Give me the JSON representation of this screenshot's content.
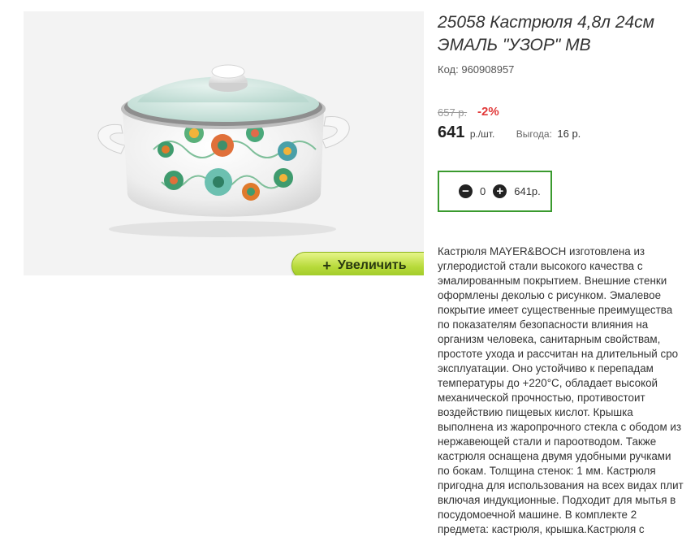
{
  "product": {
    "title": "25058 Кастрюля 4,8л 24см\nЭМАЛЬ \"УЗОР\" MB",
    "sku_label": "Код:",
    "sku_value": "960908957",
    "old_price": "657 р.",
    "discount": "-2%",
    "price": "641",
    "price_unit": "р./шт.",
    "benefit_label": "Выгода:",
    "benefit_value": "16 р."
  },
  "image": {
    "zoom_plus": "+",
    "zoom_label": "Увеличить"
  },
  "quantity": {
    "minus": "−",
    "value": "0",
    "plus": "+",
    "total": "641р."
  },
  "description": "Кастрюля MAYER&BOCH изготовлена из\nуглеродистой стали высокого качества с\nэмалированным покрытием. Внешние стенки\nоформлены деколью с рисунком. Эмалевое\nпокрытие имеет существенные преимущества\nпо показателям безопасности влияния на\nорганизм человека, санитарным свойствам,\nпростоте ухода и рассчитан на длительный сро\nэксплуатации. Оно устойчиво к перепадам\nтемпературы до +220°С, обладает высокой\nмеханической прочностью, противостоит\nвоздействию пищевых кислот. Крышка\nвыполнена из жаропрочного стекла с ободом из\nнержавеющей стали и пароотводом. Также\nкастрюля оснащена двумя удобными ручками\nпо бокам. Толщина стенок: 1 мм. Кастрюля\nпригодна для использования на всех видах плит\nвключая индукционные. Подходит для мытья в\nпосудомоечной машине. В комплекте 2\nпредмета: кастрюля, крышка.Кастрюля с",
  "colors": {
    "accent_green": "#3a9a2e",
    "discount_red": "#e13a3a",
    "zoom_button": "#b7da3a"
  }
}
